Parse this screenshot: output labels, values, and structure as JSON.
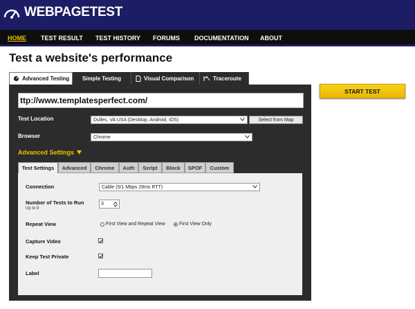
{
  "header": {
    "logo_text": "WEBPAGETEST"
  },
  "nav": {
    "items": [
      {
        "label": "HOME"
      },
      {
        "label": "TEST RESULT"
      },
      {
        "label": "TEST HISTORY"
      },
      {
        "label": "FORUMS"
      },
      {
        "label": "DOCUMENTATION"
      },
      {
        "label": "ABOUT"
      }
    ],
    "active": "HOME"
  },
  "main": {
    "title": "Test a website's performance",
    "tabs": [
      {
        "label": "Advanced Testing",
        "icon": "gauge-icon"
      },
      {
        "label": "Simple Testing"
      },
      {
        "label": "Visual Comparison",
        "icon": "document-icon"
      },
      {
        "label": "Traceroute",
        "icon": "traceroute-icon"
      }
    ],
    "url_value": "ttp://www.templatesperfect.com/",
    "test_location": {
      "label": "Test Location",
      "value": "Dulles, VA USA (Desktop, Android, iOS)",
      "map_button": "Select from Map"
    },
    "browser": {
      "label": "Browser",
      "value": "Chrome"
    },
    "advanced_settings": "Advanced Settings",
    "sub_tabs": [
      {
        "label": "Test Settings"
      },
      {
        "label": "Advanced"
      },
      {
        "label": "Chrome"
      },
      {
        "label": "Auth"
      },
      {
        "label": "Script"
      },
      {
        "label": "Block"
      },
      {
        "label": "SPOF"
      },
      {
        "label": "Custom"
      }
    ],
    "settings": {
      "connection": {
        "label": "Connection",
        "value": "Cable (5/1 Mbps 28ms RTT)"
      },
      "num_tests": {
        "label": "Number of Tests to Run",
        "sublabel": "Up to 9",
        "value": "3"
      },
      "repeat_view": {
        "label": "Repeat View",
        "options": [
          "First View and Repeat View",
          "First View Only"
        ],
        "selected": "First View Only"
      },
      "capture_video": {
        "label": "Capture Video",
        "checked": true
      },
      "keep_private": {
        "label": "Keep Test Private",
        "checked": true
      },
      "label_field": {
        "label": "Label",
        "value": ""
      }
    },
    "start_button": "START TEST"
  },
  "colors": {
    "header_bg": "#1d1d66",
    "accent_yellow": "#f1c000",
    "panel_bg": "#2c2c2c"
  }
}
